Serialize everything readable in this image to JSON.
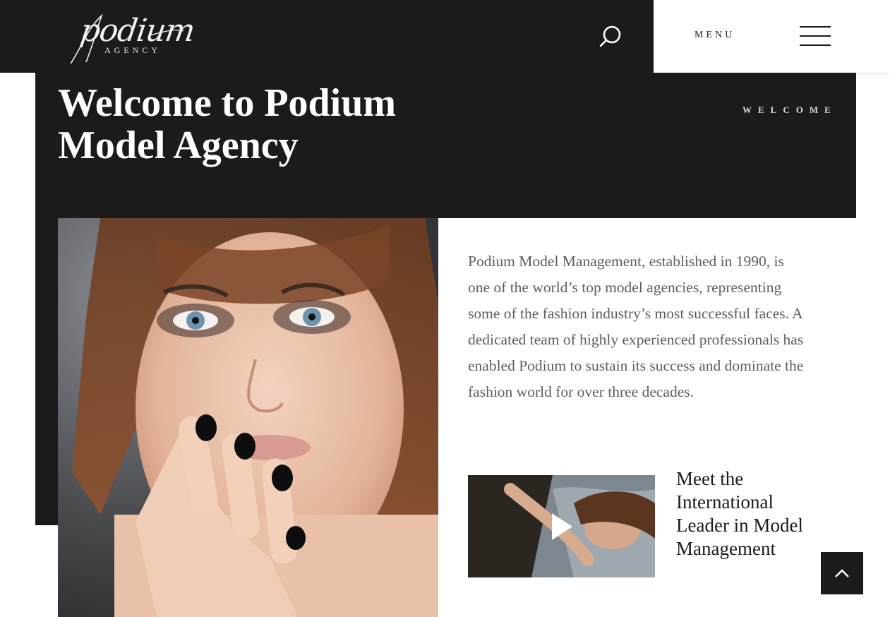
{
  "header": {
    "logo": {
      "wordmark": "podium",
      "sub": "AGENCY"
    },
    "menu_label": "MENU",
    "icons": {
      "search": "search-icon",
      "menu": "hamburger-icon"
    }
  },
  "hero": {
    "title": "Welcome to Podium Model Agency",
    "eyebrow": "WELCOME"
  },
  "intro": {
    "text": "Podium Model Management, established in 1990, is one of the world’s top model agencies, representing some of the fashion industry’s most successful faces. A dedicated team of highly experienced professionals has enabled Podium to sustain its success and dominate the fashion world for over three decades."
  },
  "video": {
    "heading": "Meet the International Leader in Model Management",
    "play_icon": "play-icon"
  },
  "back_to_top": {
    "icon": "chevron-up-icon"
  },
  "colors": {
    "dark": "#1b1b1b",
    "text": "#5e5e5e",
    "white": "#ffffff"
  }
}
